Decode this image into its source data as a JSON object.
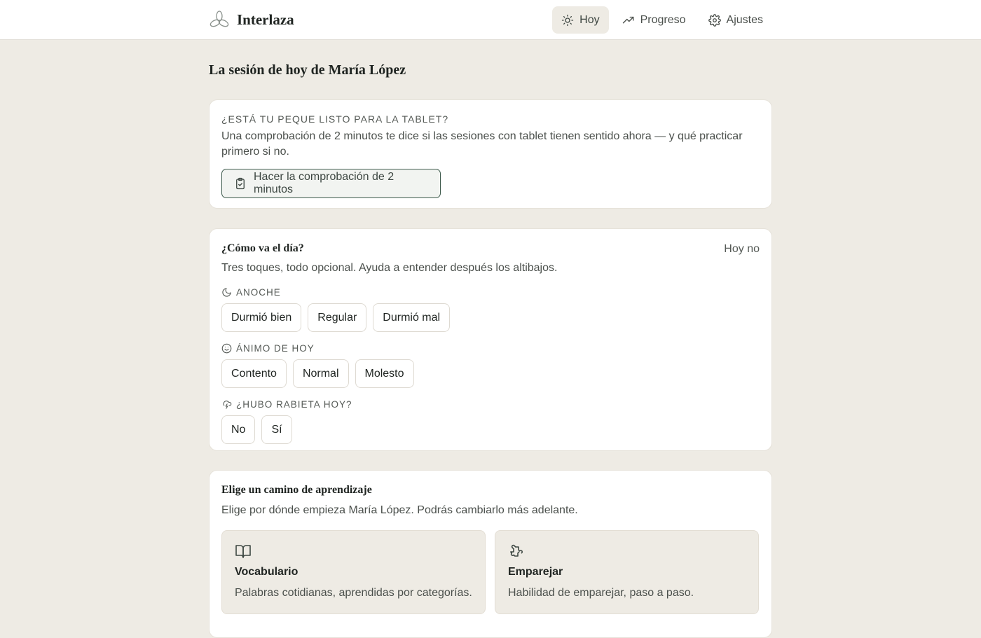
{
  "app": {
    "name": "Interlaza",
    "logo_icon": "knot-logo-icon"
  },
  "nav": [
    {
      "label": "Hoy",
      "icon": "sun-icon",
      "active": true
    },
    {
      "label": "Progreso",
      "icon": "trending-up-icon",
      "active": false
    },
    {
      "label": "Ajustes",
      "icon": "gear-icon",
      "active": false
    }
  ],
  "page": {
    "title": "La sesión de hoy de María López"
  },
  "readiness": {
    "eyebrow": "¿ESTÁ TU PEQUE LISTO PARA LA TABLET?",
    "text": "Una comprobación de 2 minutos te dice si las sesiones con tablet tienen sentido ahora — y qué practicar primero si no.",
    "button_label": "Hacer la comprobación de 2 minutos",
    "button_icon": "clipboard-check-icon"
  },
  "day": {
    "title": "¿Cómo va el día?",
    "skip_label": "Hoy no",
    "subtitle": "Tres toques, todo opcional. Ayuda a entender después los altibajos.",
    "sections": [
      {
        "label": "ANOCHE",
        "icon": "moon-icon",
        "options": [
          "Durmió bien",
          "Regular",
          "Durmió mal"
        ]
      },
      {
        "label": "ÁNIMO DE HOY",
        "icon": "smile-icon",
        "options": [
          "Contento",
          "Normal",
          "Molesto"
        ]
      },
      {
        "label": "¿HUBO RABIETA HOY?",
        "icon": "storm-cloud-icon",
        "options": [
          "No",
          "Sí"
        ]
      }
    ]
  },
  "paths": {
    "title": "Elige un camino de aprendizaje",
    "subtitle": "Elige por dónde empieza María López. Podrás cambiarlo más adelante.",
    "items": [
      {
        "title": "Vocabulario",
        "desc": "Palabras cotidianas, aprendidas por categorías.",
        "icon": "book-open-icon"
      },
      {
        "title": "Emparejar",
        "desc": "Habilidad de emparejar, paso a paso.",
        "icon": "puzzle-icon"
      }
    ]
  },
  "colors": {
    "background": "#eeebe4",
    "accent": "#3d5a4c",
    "card": "#ffffff"
  }
}
